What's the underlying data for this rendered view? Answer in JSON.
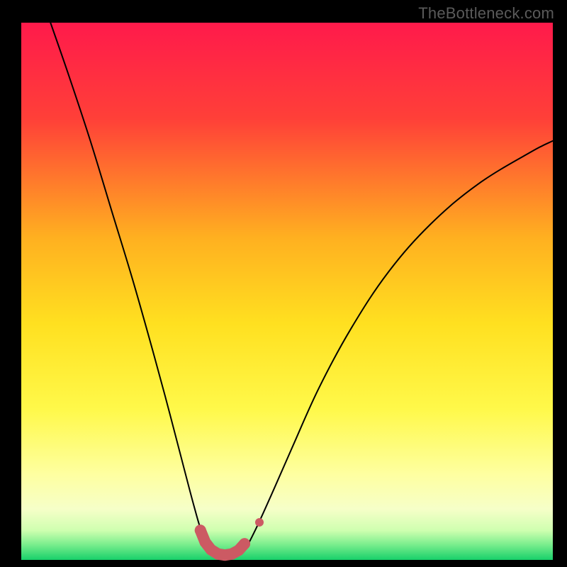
{
  "watermark": "TheBottleneck.com",
  "chart_data": {
    "type": "line",
    "title": "",
    "xlabel": "",
    "ylabel": "",
    "xlim": [
      0,
      100
    ],
    "ylim": [
      0,
      100
    ],
    "background_gradient_stops": [
      {
        "offset": 0.0,
        "color": "#ff1a4b"
      },
      {
        "offset": 0.18,
        "color": "#ff4038"
      },
      {
        "offset": 0.4,
        "color": "#ffb020"
      },
      {
        "offset": 0.56,
        "color": "#ffe020"
      },
      {
        "offset": 0.72,
        "color": "#fff94a"
      },
      {
        "offset": 0.84,
        "color": "#feffa0"
      },
      {
        "offset": 0.905,
        "color": "#f6ffc8"
      },
      {
        "offset": 0.945,
        "color": "#cfffb0"
      },
      {
        "offset": 0.97,
        "color": "#7fef8f"
      },
      {
        "offset": 1.0,
        "color": "#18d06a"
      }
    ],
    "series": [
      {
        "name": "bottleneck-curve",
        "type": "line",
        "stroke": "#000000",
        "stroke_width": 2,
        "points": [
          {
            "x": 5.5,
            "y": 100.0
          },
          {
            "x": 9.0,
            "y": 90.0
          },
          {
            "x": 13.0,
            "y": 78.0
          },
          {
            "x": 17.0,
            "y": 65.0
          },
          {
            "x": 21.0,
            "y": 52.0
          },
          {
            "x": 25.0,
            "y": 38.0
          },
          {
            "x": 28.0,
            "y": 27.0
          },
          {
            "x": 30.5,
            "y": 17.5
          },
          {
            "x": 32.5,
            "y": 10.0
          },
          {
            "x": 34.0,
            "y": 5.0
          },
          {
            "x": 35.5,
            "y": 2.0
          },
          {
            "x": 37.5,
            "y": 0.8
          },
          {
            "x": 40.0,
            "y": 0.8
          },
          {
            "x": 42.0,
            "y": 2.0
          },
          {
            "x": 44.0,
            "y": 5.5
          },
          {
            "x": 47.0,
            "y": 12.0
          },
          {
            "x": 51.0,
            "y": 21.0
          },
          {
            "x": 56.0,
            "y": 32.0
          },
          {
            "x": 62.0,
            "y": 43.0
          },
          {
            "x": 69.0,
            "y": 53.5
          },
          {
            "x": 77.0,
            "y": 62.5
          },
          {
            "x": 86.0,
            "y": 70.0
          },
          {
            "x": 96.0,
            "y": 76.0
          },
          {
            "x": 100.0,
            "y": 78.0
          }
        ]
      },
      {
        "name": "optimum-markers",
        "type": "scatter",
        "stroke": "#cc5a63",
        "fill": "#cc5a63",
        "marker_radius": 8,
        "points": [
          {
            "x": 33.7,
            "y": 5.5
          },
          {
            "x": 34.6,
            "y": 3.3
          },
          {
            "x": 35.7,
            "y": 1.9
          },
          {
            "x": 37.0,
            "y": 1.1
          },
          {
            "x": 38.3,
            "y": 0.9
          },
          {
            "x": 39.6,
            "y": 1.1
          },
          {
            "x": 40.9,
            "y": 1.8
          },
          {
            "x": 42.0,
            "y": 3.0
          },
          {
            "x": 44.8,
            "y": 7.0
          }
        ]
      }
    ]
  }
}
